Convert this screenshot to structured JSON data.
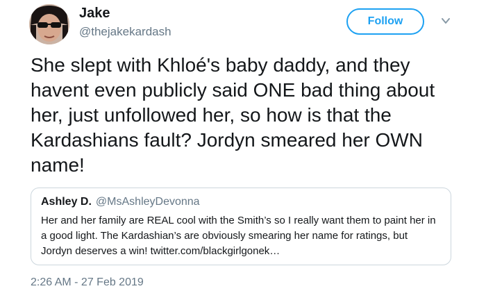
{
  "author": {
    "name": "Jake",
    "handle": "@thejakekardash",
    "avatar_icon": "user-avatar-sunglasses"
  },
  "follow_button": {
    "label": "Follow",
    "color": "#1da1f2"
  },
  "menu": {
    "icon": "chevron-down-icon"
  },
  "tweet": {
    "text": "She slept with Khloé's baby daddy, and they havent even publicly said ONE bad thing about her, just unfollowed her, so how is that the Kardashians fault? Jordyn smeared her OWN name!",
    "timestamp": "2:26 AM - 27 Feb 2019"
  },
  "quoted_tweet": {
    "name": "Ashley D.",
    "handle": "@MsAshleyDevonna",
    "text": "Her and her family are REAL cool with the Smith’s so I really want them to paint her in a good light. The Kardashian’s are obviously smearing her name for ratings, but Jordyn deserves a win! twitter.com/blackgirlgonek…"
  }
}
